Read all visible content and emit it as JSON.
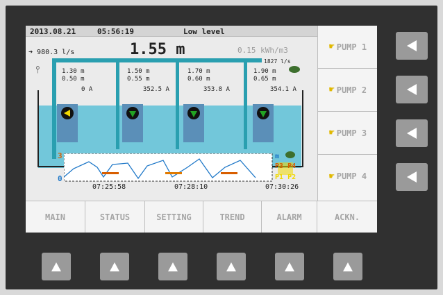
{
  "header": {
    "date": "2013.08.21",
    "time": "05:56:19",
    "status": "Low level"
  },
  "main": {
    "flow": "980.3 l/s",
    "level": "1.55",
    "level_unit": "m",
    "energy": "0.15 kWh/m3",
    "outflow": "1827 l/s"
  },
  "pumps": [
    {
      "start": "1.30 m",
      "stop": "0.50 m",
      "current": "0 A",
      "state": "off"
    },
    {
      "start": "1.50 m",
      "stop": "0.55 m",
      "current": "352.5 A",
      "state": "on"
    },
    {
      "start": "1.70 m",
      "stop": "0.60 m",
      "current": "353.8 A",
      "state": "on"
    },
    {
      "start": "1.90 m",
      "stop": "0.65 m",
      "current": "354.1 A",
      "state": "on"
    }
  ],
  "trend": {
    "ymax": "3",
    "ymin": "0",
    "unit": "m",
    "times": [
      "07:25:58",
      "07:28:10",
      "07:30:26"
    ],
    "legend": [
      "P3",
      "P4",
      "P1",
      "P2"
    ]
  },
  "pump_buttons": [
    "PUMP 1",
    "PUMP 2",
    "PUMP 3",
    "PUMP 4"
  ],
  "tabs": [
    "MAIN",
    "STATUS",
    "SETTING",
    "TREND",
    "ALARM",
    "ACKN."
  ],
  "colors": {
    "water": "#72c7da",
    "pipe": "#2a9fb0",
    "pump": "#5b8fb8",
    "on": "#23a323",
    "off": "#f0d800"
  }
}
